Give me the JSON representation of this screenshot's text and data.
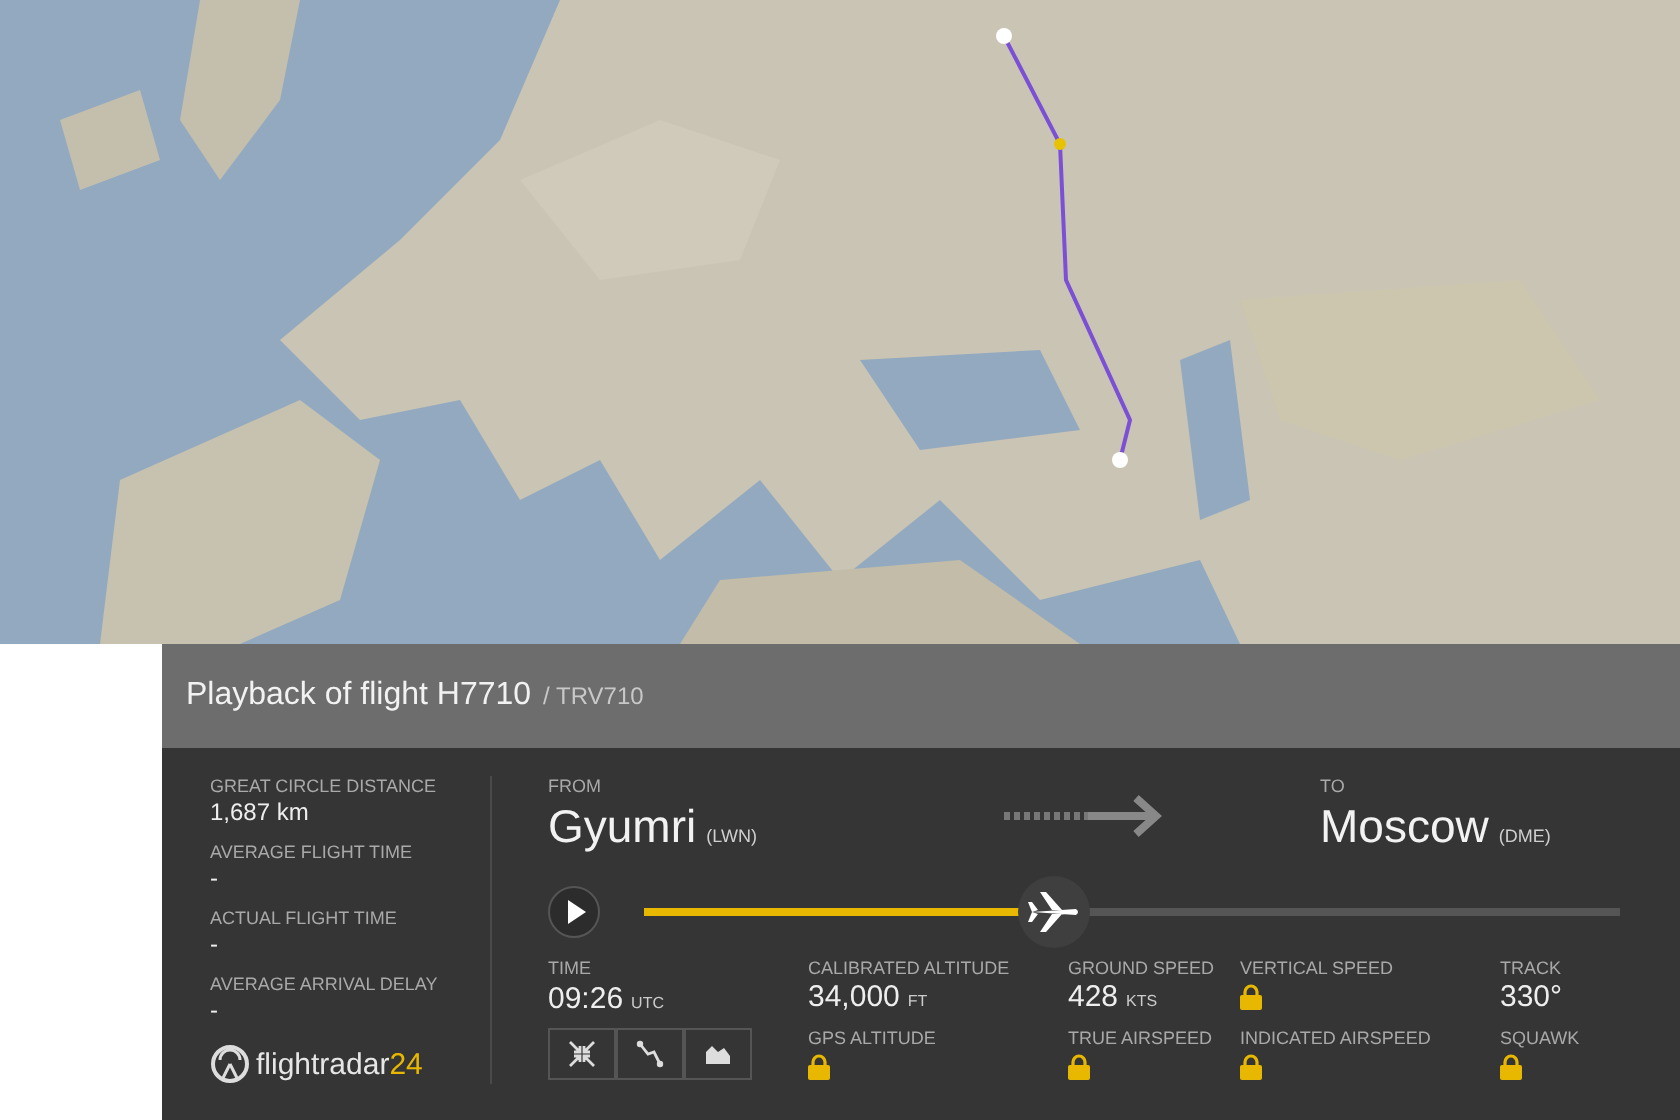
{
  "panel": {
    "title": "Playback of flight H7710",
    "subtitle": "/ TRV710"
  },
  "stats": [
    {
      "label": "GREAT CIRCLE DISTANCE",
      "value": "1,687 km"
    },
    {
      "label": "AVERAGE FLIGHT TIME",
      "value": "-"
    },
    {
      "label": "ACTUAL FLIGHT TIME",
      "value": "-"
    },
    {
      "label": "AVERAGE ARRIVAL DELAY",
      "value": "-"
    }
  ],
  "logo": {
    "name": "flightradar",
    "suffix": "24"
  },
  "from": {
    "label": "FROM",
    "city": "Gyumri",
    "code": "(LWN)"
  },
  "to": {
    "label": "TO",
    "city": "Moscow",
    "code": "(DME)"
  },
  "playback": {
    "level": 0.42
  },
  "time": {
    "label": "TIME",
    "value": "09:26",
    "unit": "UTC"
  },
  "telemetry": [
    [
      {
        "kind": "value",
        "label": "CALIBRATED ALTITUDE",
        "value": "34,000",
        "unit": "FT"
      },
      {
        "kind": "locked",
        "label": "GPS ALTITUDE"
      }
    ],
    [
      {
        "kind": "value",
        "label": "GROUND SPEED",
        "value": "428",
        "unit": "KTS"
      },
      {
        "kind": "locked",
        "label": "TRUE AIRSPEED"
      }
    ],
    [
      {
        "kind": "locked",
        "label": "VERTICAL SPEED"
      },
      {
        "kind": "locked",
        "label": "INDICATED AIRSPEED"
      }
    ],
    [
      {
        "kind": "value",
        "label": "TRACK",
        "value": "330°"
      },
      {
        "kind": "locked",
        "label": "SQUAWK"
      }
    ]
  ]
}
